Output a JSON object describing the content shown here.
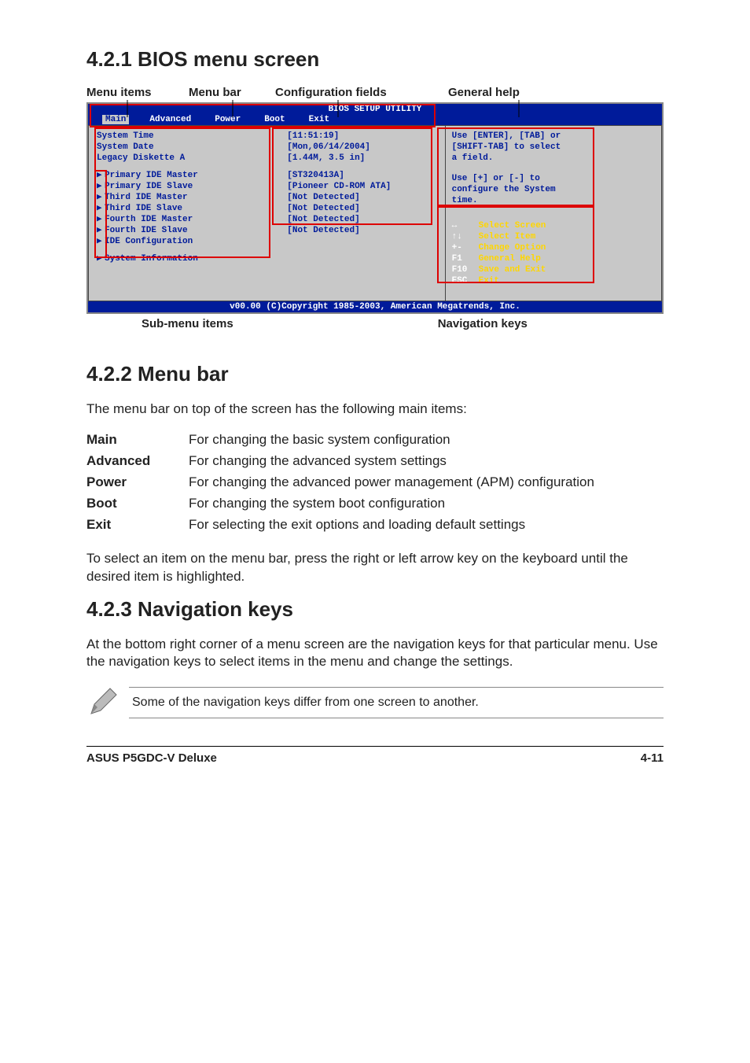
{
  "sections": {
    "s1": "4.2.1   BIOS menu screen",
    "s2": "4.2.2   Menu bar",
    "s3": "4.2.3   Navigation keys"
  },
  "annot_top": {
    "menu_items": "Menu items",
    "menu_bar": "Menu bar",
    "config_fields": "Configuration fields",
    "general_help": "General help"
  },
  "annot_bottom": {
    "submenu": "Sub-menu items",
    "navkeys": "Navigation keys"
  },
  "bios": {
    "title": "BIOS SETUP UTILITY",
    "menus": [
      "Main",
      "Advanced",
      "Power",
      "Boot",
      "Exit"
    ],
    "rows": [
      {
        "label": "System Time",
        "value": "[11:51:19]",
        "sub": false
      },
      {
        "label": "System Date",
        "value": "[Mon,06/14/2004]",
        "sub": false
      },
      {
        "label": "Legacy Diskette A",
        "value": "[1.44M, 3.5 in]",
        "sub": false
      }
    ],
    "subrows": [
      {
        "label": "Primary IDE Master",
        "value": "[ST320413A]"
      },
      {
        "label": "Primary IDE Slave",
        "value": "[Pioneer CD-ROM ATA]"
      },
      {
        "label": "Third IDE Master",
        "value": "[Not Detected]"
      },
      {
        "label": "Third IDE Slave",
        "value": "[Not Detected]"
      },
      {
        "label": "Fourth IDE Master",
        "value": "[Not Detected]"
      },
      {
        "label": "Fourth IDE Slave",
        "value": "[Not Detected]"
      },
      {
        "label": "IDE Configuration",
        "value": ""
      }
    ],
    "sysinfo": "System Information",
    "help1a": "Use [ENTER], [TAB] or",
    "help1b": "[SHIFT-TAB] to select",
    "help1c": "a field.",
    "help2a": "Use [+] or [-] to",
    "help2b": "configure the System",
    "help2c": "time.",
    "nav": [
      {
        "k": "↔",
        "d": "Select Screen"
      },
      {
        "k": "↑↓",
        "d": "Select Item"
      },
      {
        "k": "+-",
        "d": "Change Option"
      },
      {
        "k": "F1",
        "d": "General Help"
      },
      {
        "k": "F10",
        "d": "Save and Exit"
      },
      {
        "k": "ESC",
        "d": "Exit"
      }
    ],
    "footer": "v00.00 (C)Copyright 1985-2003, American Megatrends, Inc."
  },
  "menubar_intro": "The menu bar on top of the screen has the following main items:",
  "menubar_items": [
    {
      "k": "Main",
      "d": "For changing the basic system configuration"
    },
    {
      "k": "Advanced",
      "d": "For changing the advanced system settings"
    },
    {
      "k": "Power",
      "d": "For changing the advanced power management (APM) configuration"
    },
    {
      "k": "Boot",
      "d": "For changing the system boot configuration"
    },
    {
      "k": "Exit",
      "d": "For selecting the exit options and loading default settings"
    }
  ],
  "menubar_outro": "To select an item on the menu bar, press the right or left arrow key on the keyboard until the desired item is highlighted.",
  "navkeys_para": "At the bottom right corner of a menu screen are the navigation keys for that particular menu. Use the navigation keys to select items in the menu and change the settings.",
  "note": "Some of the navigation keys differ from one screen to another.",
  "footer_left": "ASUS P5GDC-V Deluxe",
  "footer_right": "4-11"
}
